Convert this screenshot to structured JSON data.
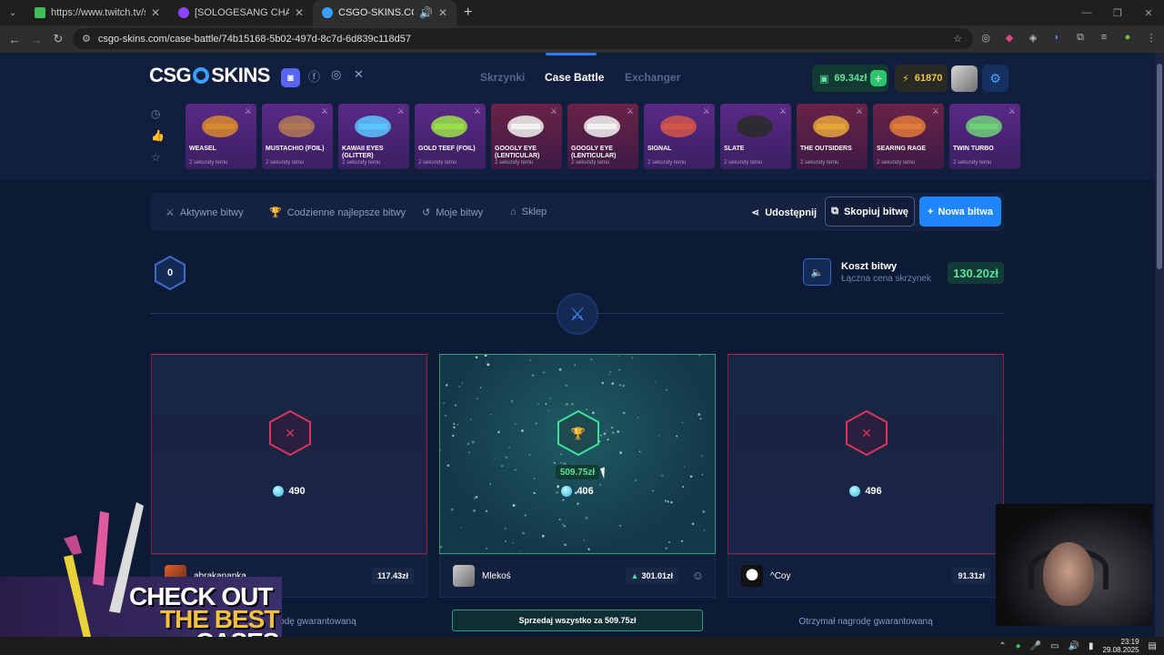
{
  "browser": {
    "tabs": [
      {
        "title": "https://www.twitch.tv/sologesa",
        "fav": "#3fbf5a"
      },
      {
        "title": "[SOLOGESANG CHALLENGE",
        "fav": "#8b44f7"
      },
      {
        "title": "CSGO-SKINS.COM - Najlep",
        "fav": "#3aa0ff"
      }
    ],
    "url": "csgo-skins.com/case-battle/74b15168-5b02-497d-8c7d-6d839c118d57"
  },
  "header": {
    "logo": "CSG",
    "logo_rest": "SKINS",
    "nav": [
      "Skrzynki",
      "Case Battle",
      "Exchanger"
    ],
    "balance": "69.34zł",
    "coins": "61870"
  },
  "drops": [
    {
      "name": "WEASEL",
      "time": "2 sekundy temu",
      "red": false,
      "color": "#d88a2e"
    },
    {
      "name": "MUSTACHIO (FOIL)",
      "time": "2 sekundy temu",
      "red": false,
      "color": "#b07a55"
    },
    {
      "name": "KAWAII EYES (GLITTER)",
      "time": "2 sekundy temu",
      "red": false,
      "color": "#5cc5ff"
    },
    {
      "name": "GOLD TEEF (FOIL)",
      "time": "2 sekundy temu",
      "red": false,
      "color": "#9be04a"
    },
    {
      "name": "GOOGLY EYE (LENTICULAR)",
      "time": "2 sekundy temu",
      "red": true,
      "color": "#f2f2f2"
    },
    {
      "name": "GOOGLY EYE (LENTICULAR)",
      "time": "2 sekundy temu",
      "red": true,
      "color": "#f2f2f2"
    },
    {
      "name": "SIGNAL",
      "time": "2 sekundy temu",
      "red": false,
      "color": "#d2564a"
    },
    {
      "name": "SLATE",
      "time": "2 sekundy temu",
      "red": false,
      "color": "#2a2a2a"
    },
    {
      "name": "THE OUTSIDERS",
      "time": "2 sekundy temu",
      "red": true,
      "color": "#e6a53a"
    },
    {
      "name": "SEARING RAGE",
      "time": "2 sekundy temu",
      "red": true,
      "color": "#e07a3a"
    },
    {
      "name": "TWIN TURBO",
      "time": "2 sekundy temu",
      "red": false,
      "color": "#6fd07a"
    }
  ],
  "toolbar": {
    "active": "Aktywne bitwy",
    "daily": "Codzienne najlepsze bitwy",
    "mine": "Moje bitwy",
    "shop": "Sklep",
    "share": "Udostępnij",
    "copy": "Skopiuj bitwę",
    "new": "Nowa bitwa"
  },
  "battle": {
    "round": "0",
    "cost_label": "Koszt bitwy",
    "cost_sub": "Łączna cena skrzynek",
    "cost": "130.20zł",
    "win_value": "509.75zł"
  },
  "players": [
    {
      "name": "abrakanapka",
      "score": "490",
      "value": "117.43zł",
      "footer": "Otrzymał nagrodę gwarantowaną",
      "winner": false
    },
    {
      "name": "Mlekoś",
      "score": "406",
      "value": "301.01zł",
      "footer": "",
      "winner": true
    },
    {
      "name": "^Coy",
      "score": "496",
      "value": "91.31zł",
      "footer": "Otrzymał nagrodę gwarantowaną",
      "winner": false
    }
  ],
  "sell_all": "Sprzedaj wszystko za 509.75zł",
  "promo": {
    "l1": "CHECK OUT",
    "l2": "THE BEST",
    "l3": "CASES"
  },
  "taskbar": {
    "time": "23:19",
    "date": "29.08.2025"
  }
}
